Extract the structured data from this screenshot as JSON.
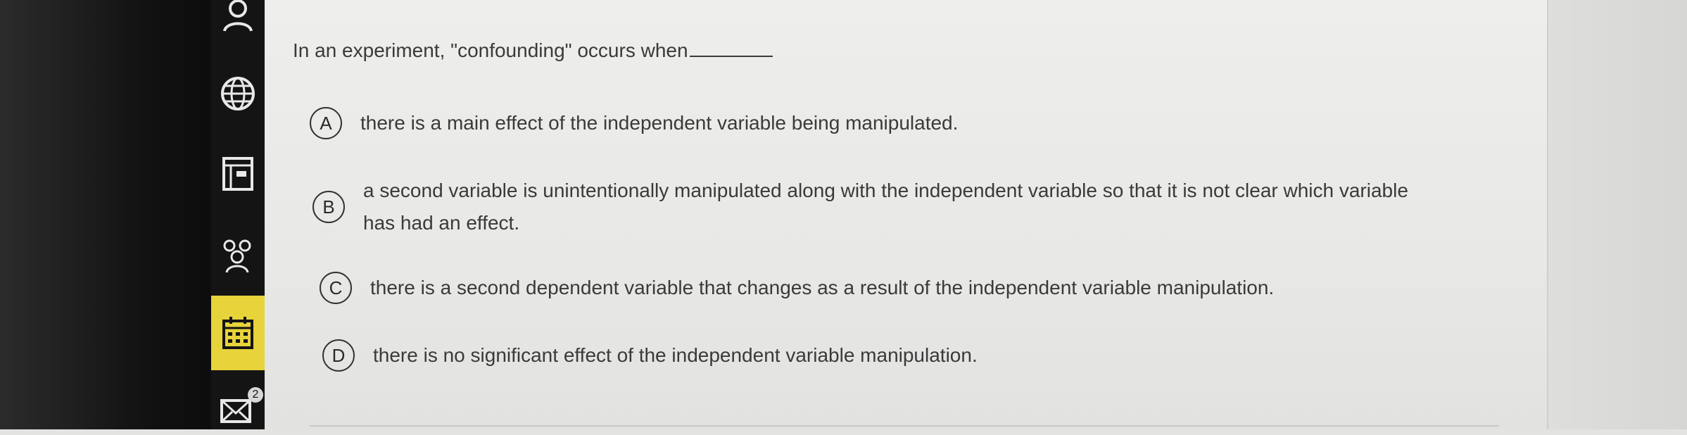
{
  "question": {
    "text": "In an experiment, \"confounding\" occurs when"
  },
  "options": [
    {
      "letter": "A",
      "text": "there is a main effect of the independent variable being manipulated."
    },
    {
      "letter": "B",
      "text": "a second variable is unintentionally manipulated along with the independent variable so that it is not clear which variable has had an effect."
    },
    {
      "letter": "C",
      "text": "there is a second dependent variable that changes as a result of the independent variable manipulation."
    },
    {
      "letter": "D",
      "text": "there is no significant effect of the independent variable manipulation."
    }
  ],
  "sidebar": {
    "active_item": "calendar",
    "items": [
      "person-icon",
      "globe-icon",
      "document-icon",
      "group-icon",
      "calendar-icon",
      "mail-icon"
    ],
    "mail_badge": "2"
  },
  "colors": {
    "active_nav": "#e7d33a",
    "rail": "#141414",
    "text": "#3a3a3a"
  }
}
